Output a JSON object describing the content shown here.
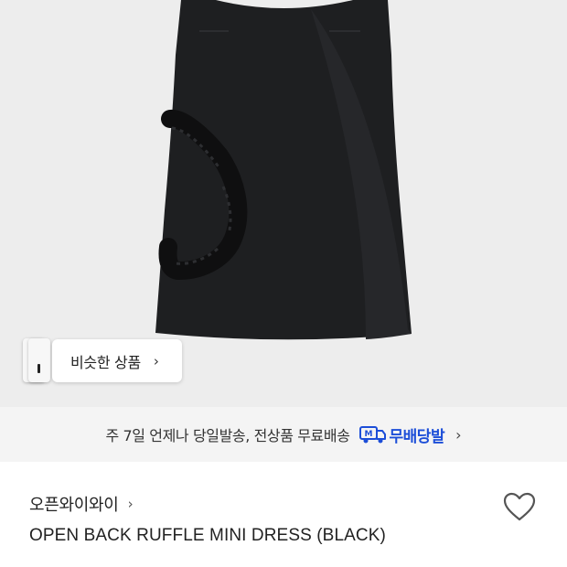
{
  "product_image": {
    "similar_button_label": "비슷한 상품",
    "chevron": "›"
  },
  "delivery_banner": {
    "text": "주 7일 언제나 당일발송, 전상품 무료배송",
    "badge_label": "무배당발",
    "badge_icon": "truck-m-icon",
    "accent_color": "#1c4ed8",
    "chevron": "›"
  },
  "product": {
    "brand": "오픈와이와이",
    "brand_chevron": "›",
    "title": "OPEN BACK RUFFLE MINI DRESS (BLACK)",
    "wishlist_icon": "heart-outline-icon"
  }
}
